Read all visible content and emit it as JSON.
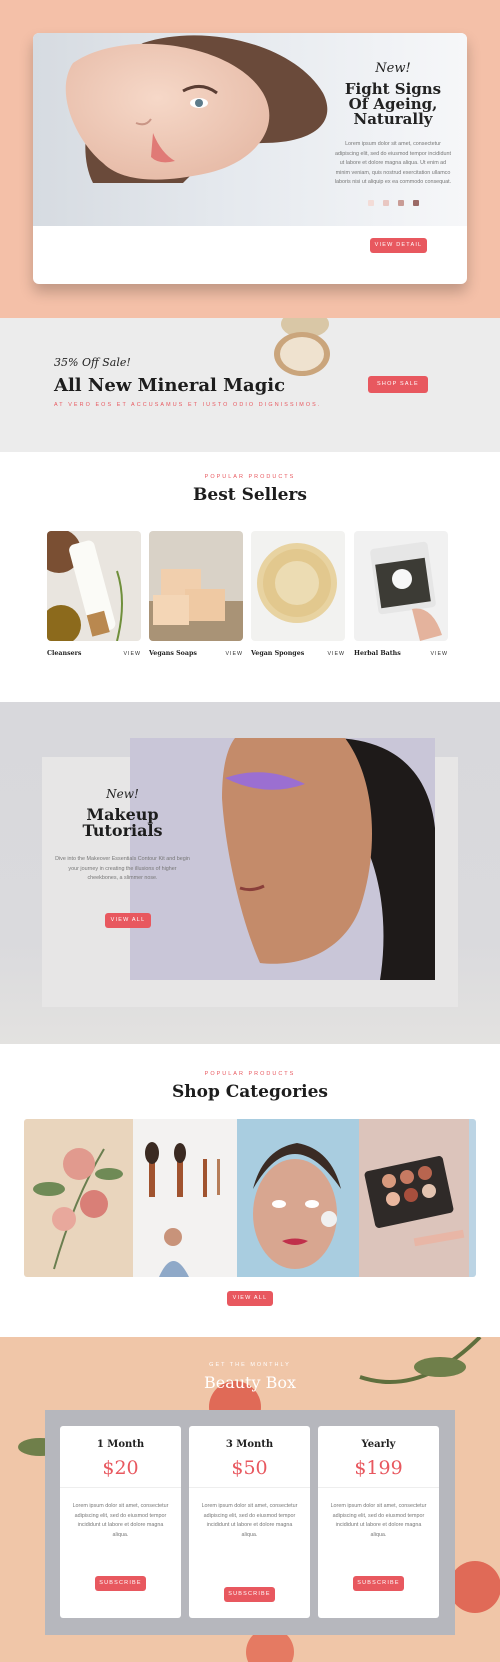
{
  "hero": {
    "new_label": "New!",
    "title": "Fight Signs Of Ageing, Naturally",
    "text": "Lorem ipsum dolor sit amet, consectetur adipiscing elit, sed do eiusmod tempor incididunt ut labore et dolore magna aliqua. Ut enim ad minim veniam, quis nostrud exercitation ullamco laboris nisi ut aliquip ex ea commodo consequat.",
    "swatches": [
      "#f3dcd7",
      "#e9c7c2",
      "#c99c96",
      "#9b6a66"
    ],
    "button": "View Detail"
  },
  "promo": {
    "offer": "35% Off Sale!",
    "title": "All New Mineral Magic",
    "subtitle": "At vero eos et accusamus et iusto odio dignissimos.",
    "button": "Shop Sale"
  },
  "best_sellers": {
    "eyebrow": "Popular Products",
    "title": "Best Sellers",
    "products": [
      {
        "name": "Cleansers",
        "action": "View"
      },
      {
        "name": "Vegans Soaps",
        "action": "View"
      },
      {
        "name": "Vegan Sponges",
        "action": "View"
      },
      {
        "name": "Herbal Baths",
        "action": "View"
      }
    ]
  },
  "makeup": {
    "new_label": "New!",
    "title": "Makeup Tutorials",
    "text": "Dive into the Makeover Essentials Contour Kit and begin your journey in creating the illusions of higher cheekbones, a slimmer nose.",
    "button": "View All"
  },
  "categories": {
    "eyebrow": "Popular Products",
    "title": "Shop Categories",
    "button": "View All"
  },
  "beauty_box": {
    "eyebrow": "Get the Monthly",
    "title": "Beauty Box",
    "plans": [
      {
        "name": "1 Month",
        "price": "$20",
        "text": "Lorem ipsum dolor sit amet, consectetur adipiscing elit, sed do eiusmod tempor incididunt ut labore et dolore magna aliqua.",
        "button": "Subscribe"
      },
      {
        "name": "3 Month",
        "price": "$50",
        "text": "Lorem ipsum dolor sit amet, consectetur adipiscing elit, sed do eiusmod tempor incididunt ut labore et dolore magna aliqua.",
        "button": "Subscribe"
      },
      {
        "name": "Yearly",
        "price": "$199",
        "text": "Lorem ipsum dolor sit amet, consectetur adipiscing elit, sed do eiusmod tempor incididunt ut labore et dolore magna aliqua.",
        "button": "Subscribe"
      }
    ]
  },
  "colors": {
    "accent": "#e8585f",
    "hero_bg": "#f4c0a8",
    "promo_bg": "#ececec"
  }
}
